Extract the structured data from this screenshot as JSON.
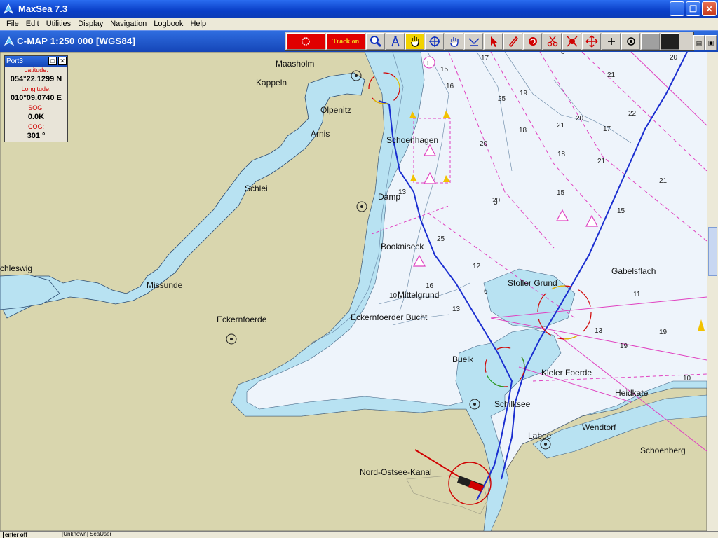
{
  "window": {
    "title": "MaxSea 7.3",
    "buttons": {
      "minimize": "_",
      "maximize": "❐",
      "close": "✕"
    }
  },
  "menu": [
    "File",
    "Edit",
    "Utilities",
    "Display",
    "Navigation",
    "Logbook",
    "Help"
  ],
  "chart": {
    "title": "C-MAP  1:250 000 [WGS84]"
  },
  "toolbar": {
    "track_label": "Track on",
    "icons": [
      "record-icon",
      "track-toggle",
      "zoom-icon",
      "compass-icon",
      "hand-pan-icon",
      "cursor-cross-icon",
      "grab-icon",
      "measure-icon",
      "arrow-pointer-icon",
      "pencil-icon",
      "rotate-icon",
      "scissors-icon",
      "route-icon",
      "move-icon",
      "plus-icon",
      "target-icon"
    ],
    "colors": {
      "active_red": "#e00000",
      "track_text": "#f5d020"
    }
  },
  "port_panel": {
    "title": "Port3",
    "latitude_label": "Latitude:",
    "latitude": "054°22.1299 N",
    "longitude_label": "Longitude:",
    "longitude": "010°09.0740 E",
    "sog_label": "SOG:",
    "sog": "0.0K",
    "cog_label": "COG:",
    "cog": "301 °"
  },
  "places": {
    "maasholm": "Maasholm",
    "kappeln": "Kappeln",
    "olpenitz": "Olpenitz",
    "arnis": "Arnis",
    "schlei": "Schlei",
    "schleswig": "chleswig",
    "missunde": "Missunde",
    "schoenhagen": "Schoenhagen",
    "damp": "Damp",
    "bookniseck": "Bookniseck",
    "mittelgrund": "Mittelgrund",
    "eckernfoerde_bucht": "Eckernfoerder Bucht",
    "eckernfoerde": "Eckernfoerde",
    "stoller_grund": "Stoller Grund",
    "gabelsflach": "Gabelsflach",
    "buelk": "Buelk",
    "kieler_foerde": "Kieler Foerde",
    "heidkate": "Heidkate",
    "schilksee": "Schilksee",
    "wendtorf": "Wendtorf",
    "laboe": "Laboe",
    "schoenberg": "Schoenberg",
    "nord_ostsee_kanal": "Nord-Ostsee-Kanal"
  },
  "depths": [
    "15",
    "16",
    "17",
    "19",
    "21",
    "22",
    "20",
    "18",
    "25",
    "13",
    "10",
    "20",
    "19",
    "15",
    "21",
    "21",
    "18",
    "17",
    "21",
    "16",
    "13",
    "11",
    "10",
    "19",
    "20",
    "6",
    "5",
    "12",
    "13",
    "8",
    "15",
    "20",
    "25"
  ],
  "map_colors": {
    "sea": "#eef4fb",
    "shallow": "#b8e2f2",
    "land": "#d9d6ae",
    "track": "#1a2ed0",
    "limits": "#e040c0"
  },
  "status": {
    "left": "enter off",
    "user": "[Unknown]  SeaUser"
  }
}
